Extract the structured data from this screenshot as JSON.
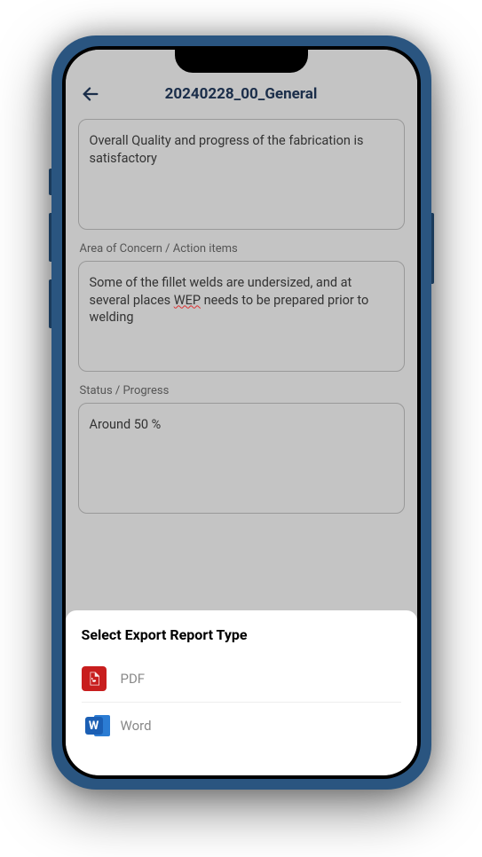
{
  "header": {
    "title": "20240228_00_General"
  },
  "fields": {
    "quality": {
      "text": "Overall Quality and progress of the fabrication is satisfactory"
    },
    "concern": {
      "label": "Area of Concern / Action items",
      "text_pre": "Some of the fillet welds are undersized, and at several places ",
      "text_spell": "WEP",
      "text_post": " needs to be prepared prior to welding"
    },
    "status": {
      "label": "Status / Progress",
      "text": "Around 50 %"
    }
  },
  "sheet": {
    "title": "Select Export Report Type",
    "options": {
      "pdf": "PDF",
      "word": "Word"
    }
  }
}
